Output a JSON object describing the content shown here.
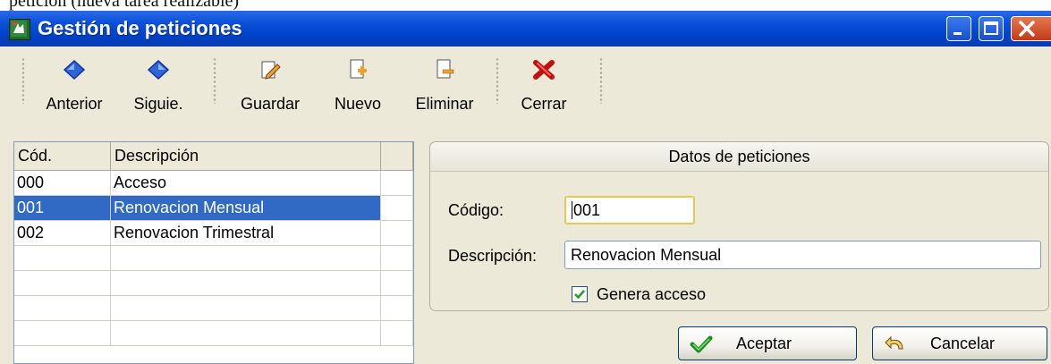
{
  "document_strip": {
    "text": "petición (nueva tarea realizable)"
  },
  "window": {
    "title": "Gestión de peticiones"
  },
  "toolbar": {
    "previous_label": "Anterior",
    "next_label": "Siguie.",
    "save_label": "Guardar",
    "new_label": "Nuevo",
    "delete_label": "Eliminar",
    "close_label": "Cerrar"
  },
  "grid": {
    "headers": [
      "Cód.",
      "Descripción",
      ""
    ],
    "rows": [
      {
        "code": "000",
        "description": "Acceso"
      },
      {
        "code": "001",
        "description": "Renovacion Mensual",
        "selected": true
      },
      {
        "code": "002",
        "description": "Renovacion Trimestral"
      },
      {
        "code": "",
        "description": ""
      },
      {
        "code": "",
        "description": ""
      },
      {
        "code": "",
        "description": ""
      },
      {
        "code": "",
        "description": ""
      }
    ]
  },
  "form": {
    "group_title": "Datos de peticiones",
    "code_label": "Código:",
    "code_value": "001",
    "description_label": "Descripción:",
    "description_value": "Renovacion Mensual",
    "generates_access_label": "Genera acceso",
    "generates_access_checked": true
  },
  "buttons": {
    "accept_label": "Aceptar",
    "cancel_label": "Cancelar"
  },
  "colors": {
    "titlebar": "#0a4fd8",
    "selection": "#316ac5",
    "window_bg": "#ece9d8"
  }
}
